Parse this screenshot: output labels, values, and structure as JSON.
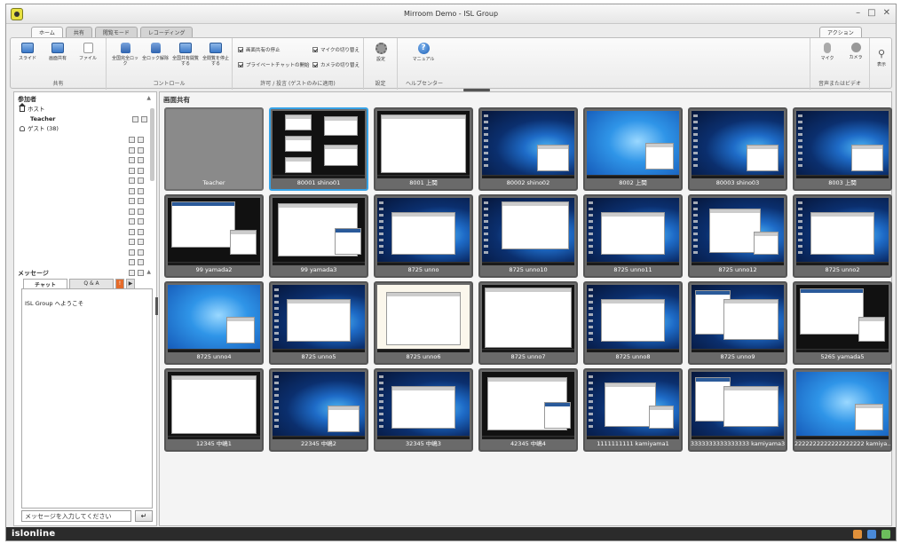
{
  "window": {
    "title": "Mirroom Demo  - ISL Group",
    "controls": [
      "–",
      "□",
      "✕"
    ]
  },
  "ribbon": {
    "tabs": [
      "ホーム",
      "共有",
      "閲覧モード",
      "レコーディング"
    ],
    "action_tab": "アクション",
    "groups": {
      "share": {
        "label": "共有",
        "buttons": [
          "スライド",
          "画面共有",
          "ファイル"
        ]
      },
      "control": {
        "label": "コントロール",
        "buttons": [
          "全国完全ロック",
          "全ロック解除",
          "全国共有開覧する",
          "全閲覧を停止する"
        ]
      },
      "perm": {
        "label": "許可 / 投言 (ゲストのみに適用)",
        "checks": [
          "画面共有の停止",
          "プライベートチャットの開始",
          "マイクの切り替え",
          "カメラの切り替え"
        ]
      },
      "settings": {
        "label": "設定",
        "button": "設定"
      },
      "help": {
        "label": "ヘルプセンター",
        "button": "マニュアル"
      },
      "av": {
        "label": "音声またはビデオ",
        "buttons": [
          "マイク",
          "カメラ"
        ]
      },
      "display": {
        "button": "表示"
      }
    }
  },
  "participants": {
    "header": "参加者",
    "host_label": "ホスト",
    "host_name": "Teacher",
    "guest_label": "ゲスト (38)"
  },
  "messages": {
    "header": "メッセージ",
    "tabs": [
      "チャット",
      "Q & A",
      "!",
      "▶"
    ],
    "welcome": "ISL Group へようこそ",
    "input_value": "メッセージを入力してください",
    "send_icon": "↵"
  },
  "main": {
    "title": "画面共有",
    "thumbnails": [
      {
        "label": "Teacher",
        "kind": "teacher"
      },
      {
        "label": "80001 shino01",
        "kind": "mirror"
      },
      {
        "label": "8001 上関",
        "kind": "browser"
      },
      {
        "label": "80002 shino02",
        "kind": "desk"
      },
      {
        "label": "8002 上関",
        "kind": "bright"
      },
      {
        "label": "80003 shino03",
        "kind": "desk"
      },
      {
        "label": "8003 上関",
        "kind": "desk"
      },
      {
        "label": "99 yamada2",
        "kind": "darkapp"
      },
      {
        "label": "99 yamada3",
        "kind": "browser2"
      },
      {
        "label": "8725 unno",
        "kind": "deskwhite"
      },
      {
        "label": "8725 unno10",
        "kind": "browserdesk"
      },
      {
        "label": "8725 unno11",
        "kind": "deskwhite"
      },
      {
        "label": "8725 unno12",
        "kind": "deskfiles"
      },
      {
        "label": "8725 unno2",
        "kind": "deskwhite"
      },
      {
        "label": "8725 unno4",
        "kind": "bright"
      },
      {
        "label": "8725 unno5",
        "kind": "deskwhite"
      },
      {
        "label": "8725 unno6",
        "kind": "light"
      },
      {
        "label": "8725 unno7",
        "kind": "spread"
      },
      {
        "label": "8725 unno8",
        "kind": "deskwhite"
      },
      {
        "label": "8725 unno9",
        "kind": "multiwin"
      },
      {
        "label": "5265 yamada5",
        "kind": "darkapp"
      },
      {
        "label": "12345 中嶋1",
        "kind": "browser"
      },
      {
        "label": "22345 中嶋2",
        "kind": "desk"
      },
      {
        "label": "32345 中嶋3",
        "kind": "deskwhite"
      },
      {
        "label": "42345 中嶋4",
        "kind": "browser2"
      },
      {
        "label": "1111111111 kamiyama1",
        "kind": "deskfiles"
      },
      {
        "label": "3333333333333333 kamiyama3",
        "kind": "multiwin"
      },
      {
        "label": "2222222222222222222 kamiya...",
        "kind": "bright"
      }
    ]
  },
  "statusbar": {
    "brand": "islonline"
  },
  "colors": {
    "selected_border": "#36a2e6",
    "brand_bg": "#2b2b2b"
  }
}
